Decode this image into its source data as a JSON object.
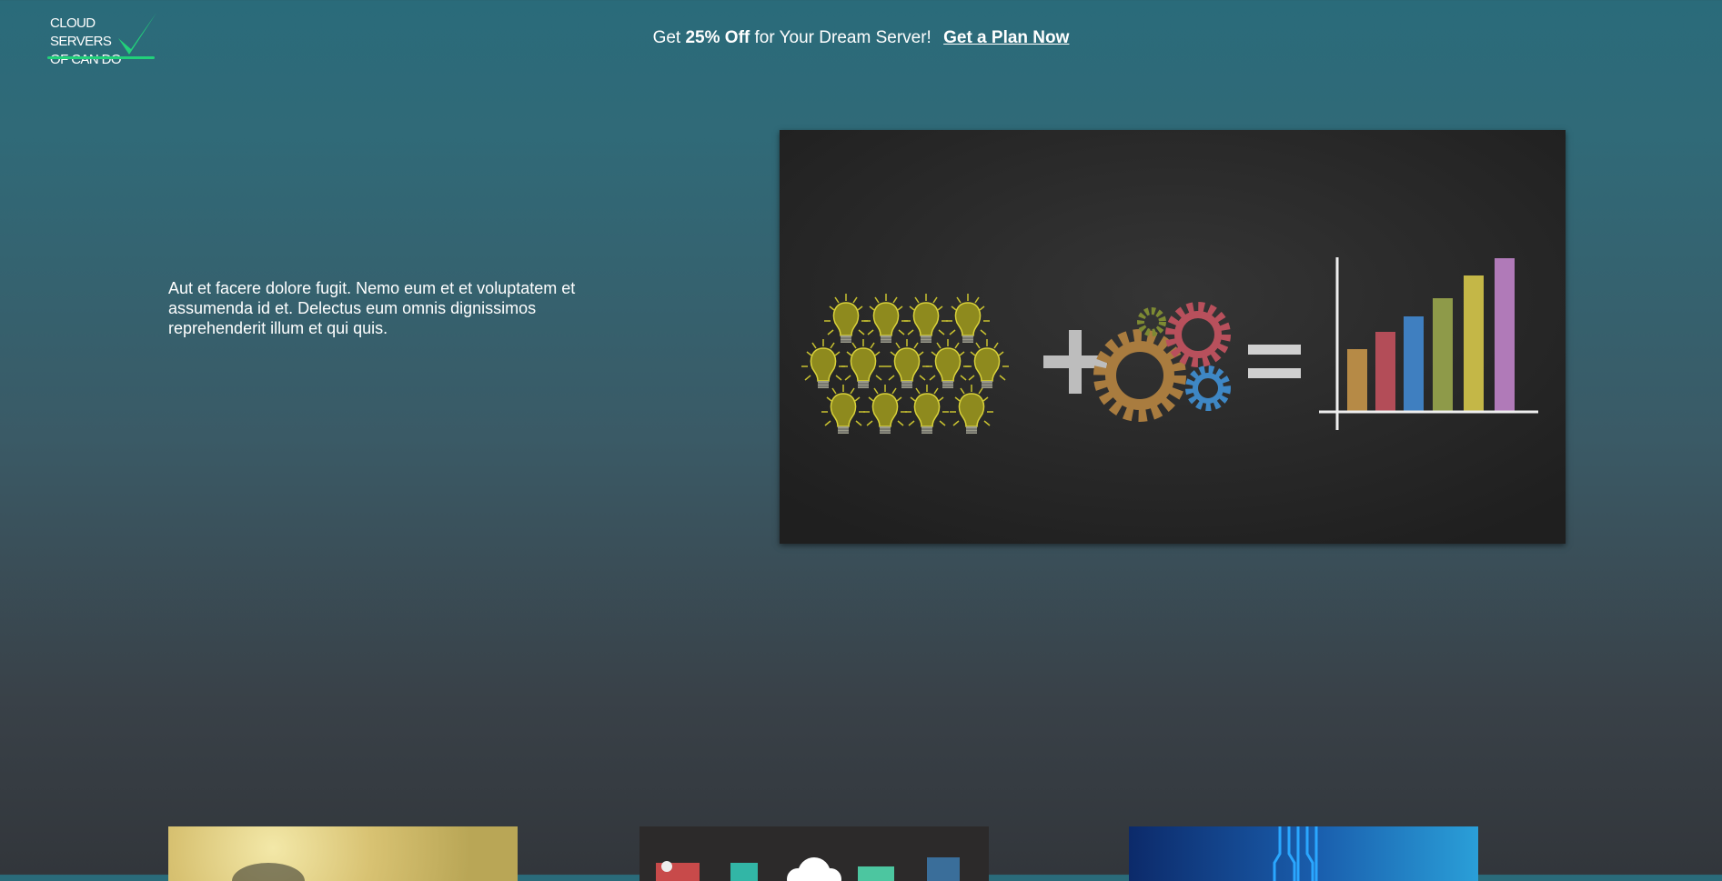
{
  "logo": {
    "line1": "CLOUD SERVERS",
    "line2": "OF CAN DO"
  },
  "promo": {
    "prefix": "Get ",
    "highlight": "25% Off",
    "suffix": " for Your Dream Server!",
    "cta": "Get a Plan Now"
  },
  "hero": {
    "text": "Aut et facere dolore fugit. Nemo eum et et voluptatem et assumenda id et. Delectus eum omnis dignissimos reprehenderit illum et qui quis."
  },
  "colors": {
    "accent": "#22d17a",
    "chalkboard": "#2b2b2b"
  }
}
